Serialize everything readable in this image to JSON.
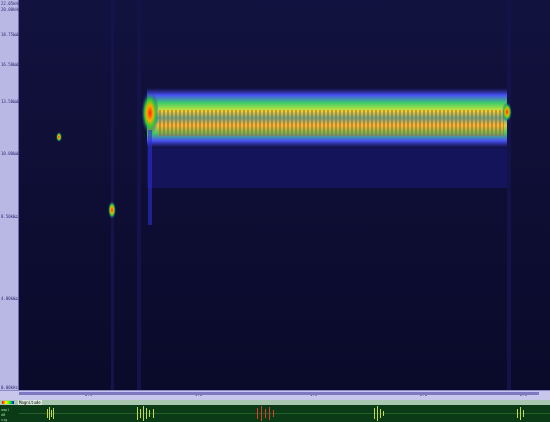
{
  "axis": {
    "ticks": [
      "22.05kHz",
      "20.00kHz",
      "18.75kHz",
      "16.50kHz",
      "13.50kHz",
      "10.00kHz",
      "8.50kHz",
      "4.00kHz",
      "0.00kHz"
    ]
  },
  "timeline": {
    "labels": [
      "0.5",
      "1.0",
      "1.5",
      "2.0",
      "2.5"
    ]
  },
  "waveform": {
    "label": "Magnitude",
    "scale": [
      "ampl",
      "dB",
      "sig"
    ]
  },
  "colors": {
    "background": "#0a0a2a",
    "axis": "#b9b7e4",
    "waveform_bg": "#0b3a16",
    "waveform_line": "#c4d94a"
  }
}
